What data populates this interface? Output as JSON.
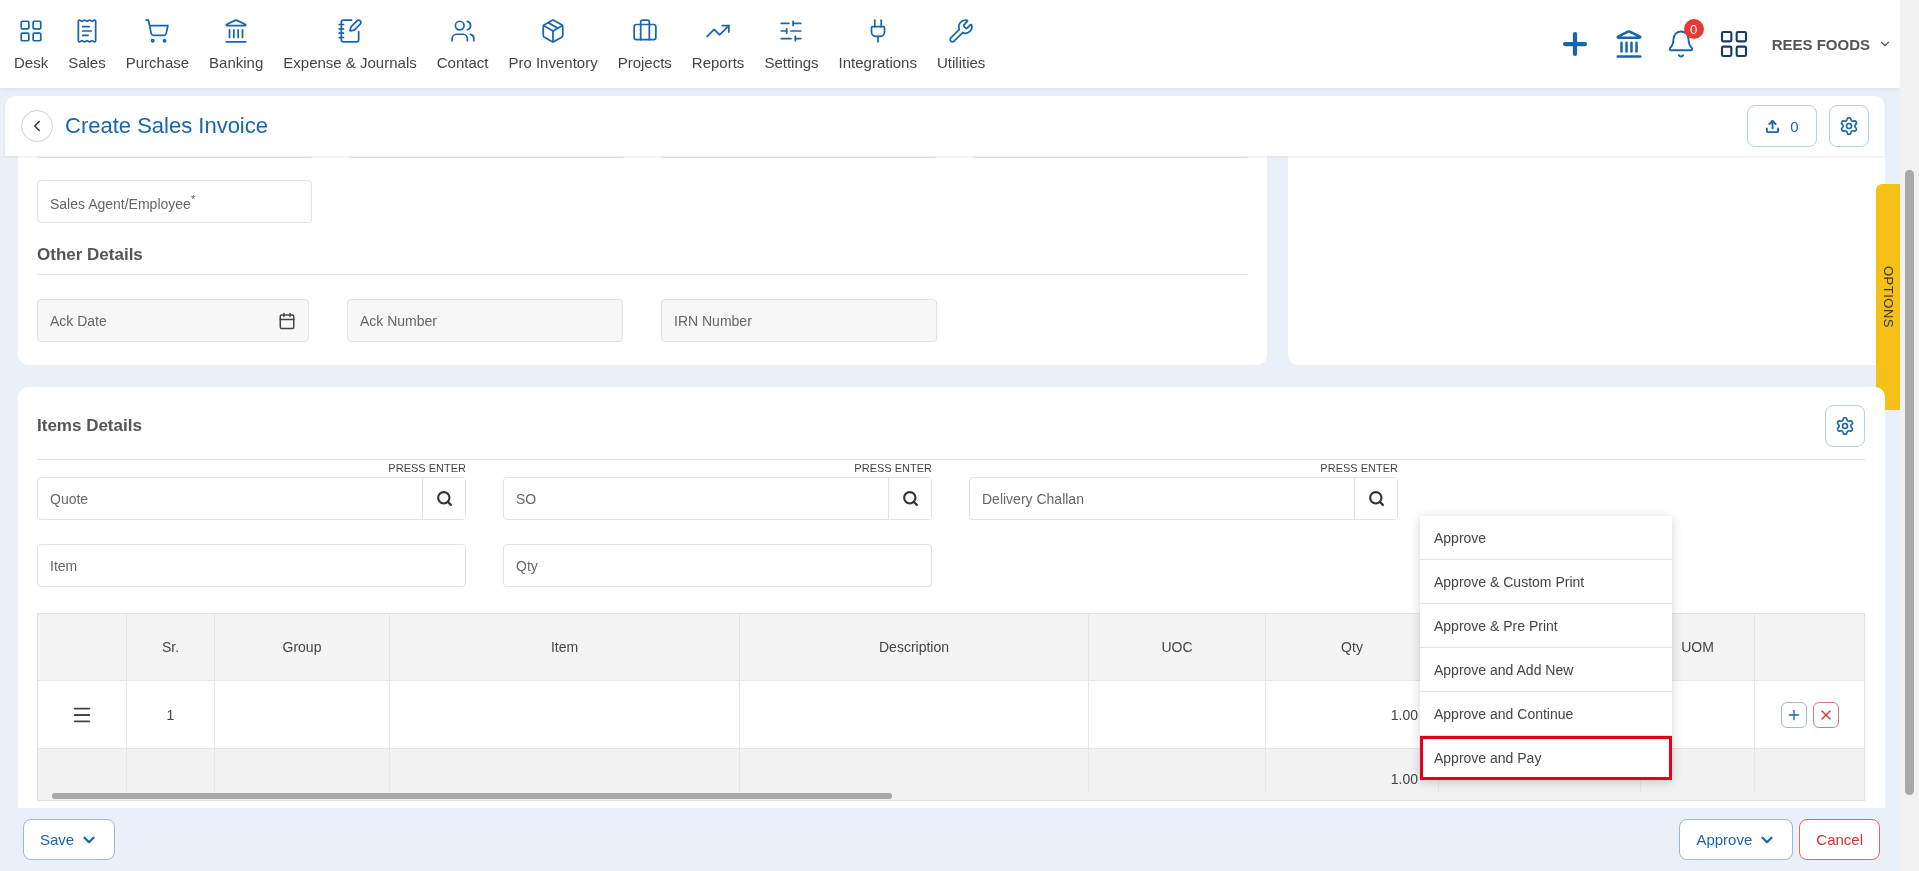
{
  "nav": {
    "items": [
      {
        "label": "Desk"
      },
      {
        "label": "Sales"
      },
      {
        "label": "Purchase"
      },
      {
        "label": "Banking"
      },
      {
        "label": "Expense & Journals"
      },
      {
        "label": "Contact"
      },
      {
        "label": "Pro Inventory"
      },
      {
        "label": "Projects"
      },
      {
        "label": "Reports"
      },
      {
        "label": "Settings"
      },
      {
        "label": "Integrations"
      },
      {
        "label": "Utilities"
      }
    ],
    "notifications": "0",
    "company": "REES FOODS"
  },
  "page": {
    "title": "Create Sales Invoice",
    "attachments": "0"
  },
  "form": {
    "sales_agent": {
      "placeholder": "Sales Agent/Employee$^{*}$"
    },
    "other_details": {
      "title": "Other Details",
      "fields": [
        {
          "placeholder": "Ack Date",
          "kind": "date"
        },
        {
          "placeholder": "Ack Number",
          "kind": "text"
        },
        {
          "placeholder": "IRN Number",
          "kind": "text"
        }
      ]
    }
  },
  "options_tab": "OPTIONS",
  "items": {
    "title": "Items Details",
    "lookups": [
      {
        "placeholder": "Quote",
        "hint": "PRESS ENTER"
      },
      {
        "placeholder": "SO",
        "hint": "PRESS ENTER"
      },
      {
        "placeholder": "Delivery Challan",
        "hint": "PRESS ENTER"
      }
    ],
    "entry_fields": [
      {
        "placeholder": "Item"
      },
      {
        "placeholder": "Qty"
      }
    ],
    "table": {
      "columns": [
        {},
        {
          "label": "Sr."
        },
        {
          "label": "Group"
        },
        {
          "label": "Item"
        },
        {
          "label": "Description"
        },
        {
          "label": "UOC"
        },
        {
          "label": "Qty"
        },
        {},
        {
          "label": "UOM"
        },
        {}
      ],
      "rows": [
        {
          "kind": "item",
          "sr": "1",
          "qty": "1.00"
        },
        {
          "kind": "total",
          "qty": "1.00"
        }
      ]
    }
  },
  "approve_menu": [
    {
      "label": "Approve",
      "selected": false
    },
    {
      "label": "Approve & Custom Print",
      "selected": false
    },
    {
      "label": "Approve & Pre Print",
      "selected": false
    },
    {
      "label": "Approve and Add New",
      "selected": false
    },
    {
      "label": "Approve and Continue",
      "selected": false
    },
    {
      "label": "Approve and Pay",
      "selected": true
    }
  ],
  "footer": {
    "save": "Save",
    "approve": "Approve",
    "cancel": "Cancel"
  }
}
